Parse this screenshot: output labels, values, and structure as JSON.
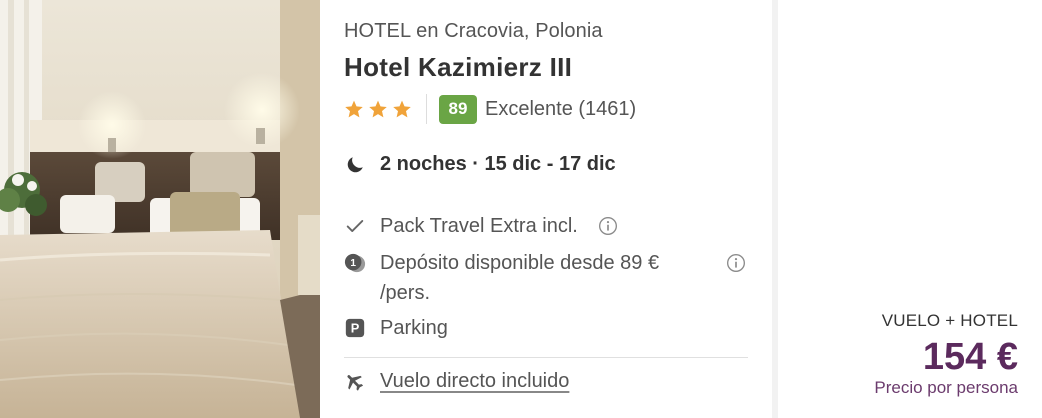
{
  "hotel": {
    "location": "HOTEL en Cracovia, Polonia",
    "name": "Hotel Kazimierz III",
    "stars": 3,
    "score": "89",
    "score_label": "Excelente (1461)",
    "photo_icon": "hotel-room-photo"
  },
  "stay": {
    "text": "2 noches · 15 dic - 17 dic"
  },
  "features": {
    "pack": "Pack Travel Extra incl.",
    "deposit": "Depósito disponible desde 89 € /pers.",
    "parking": "Parking"
  },
  "flight": {
    "link": "Vuelo directo incluido"
  },
  "price": {
    "label": "VUELO + HOTEL",
    "value": "154 €",
    "sub": "Precio por persona"
  },
  "colors": {
    "star": "#f0a33a",
    "score_badge": "#6aa545",
    "price": "#5b2a5d"
  }
}
